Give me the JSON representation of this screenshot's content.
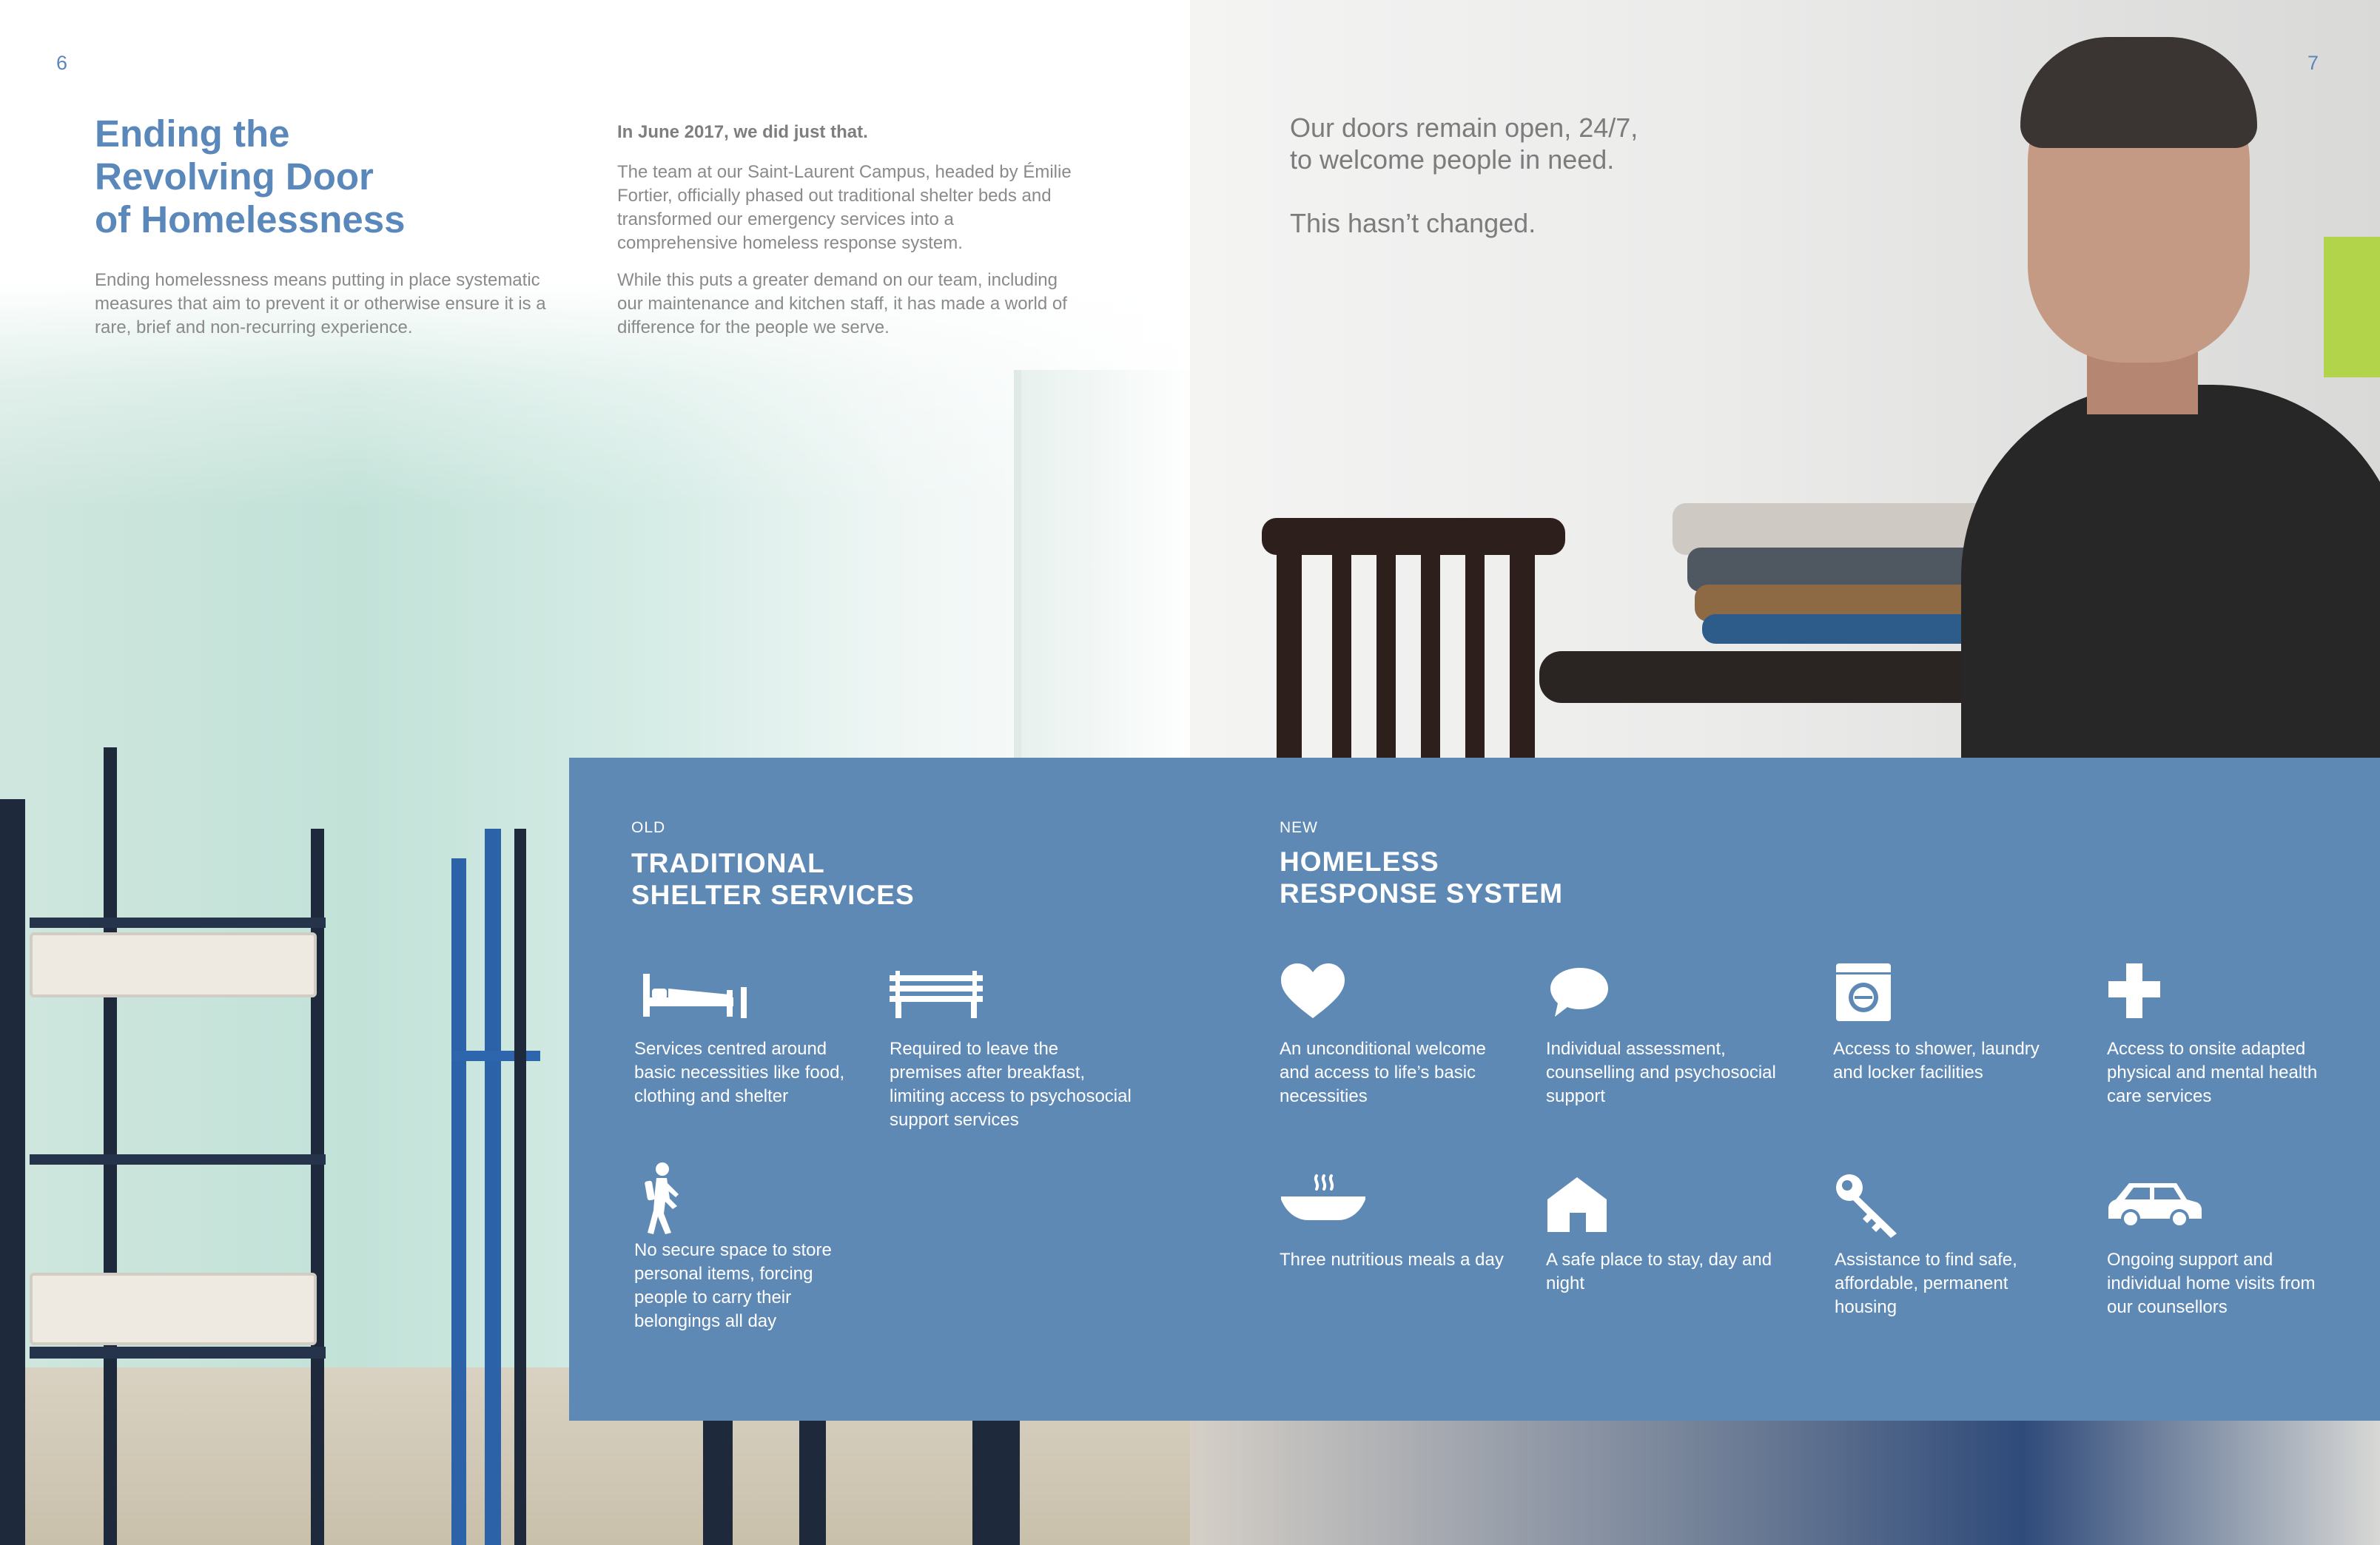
{
  "page_numbers": {
    "left": "6",
    "right": "7"
  },
  "article": {
    "title_lines": [
      "Ending the",
      "Revolving Door",
      "of Homelessness"
    ],
    "intro": "Ending homelessness means putting in place systematic measures that aim to prevent it or otherwise ensure it is a rare, brief and non-recurring experience.",
    "lead": "In June 2017, we did just that.",
    "paragraph_1": "The team at our Saint-Laurent Campus, headed by Émilie Fortier, officially phased out traditional shelter beds and transformed our emergency services into a comprehensive homeless response system.",
    "paragraph_2": "While this puts a greater demand on our team, including our maintenance and kitchen staff, it has made a world of difference for the people we serve."
  },
  "quote": {
    "line_1": "Our doors remain open, 24/7,",
    "line_2": "to welcome people in need.",
    "line_3": "This hasn’t changed."
  },
  "panel": {
    "color": "#5f89b5",
    "old": {
      "kicker": "OLD",
      "heading_lines": [
        "TRADITIONAL",
        "SHELTER SERVICES"
      ],
      "items": [
        {
          "icon": "bed-icon",
          "caption": "Services centred around basic necessities like food, clothing and shelter"
        },
        {
          "icon": "bench-icon",
          "caption": "Required to leave the premises after breakfast, limiting access to psychosocial support services"
        },
        {
          "icon": "walking-person-icon",
          "caption": "No secure space to store personal items, forcing people to carry their belongings all day"
        }
      ]
    },
    "new": {
      "kicker": "NEW",
      "heading_lines": [
        "HOMELESS",
        "RESPONSE SYSTEM"
      ],
      "items": [
        {
          "icon": "heart-icon",
          "caption": "An unconditional welcome and access to life’s basic necessities"
        },
        {
          "icon": "speech-bubble-icon",
          "caption": "Individual assessment, counselling and psychosocial support"
        },
        {
          "icon": "washing-machine-icon",
          "caption": "Access to shower, laundry and locker facilities"
        },
        {
          "icon": "medical-cross-icon",
          "caption": "Access to onsite adapted physical and mental health care services"
        },
        {
          "icon": "hot-meal-bowl-icon",
          "caption": "Three nutritious meals a day"
        },
        {
          "icon": "house-icon",
          "caption": "A safe place to stay, day and night"
        },
        {
          "icon": "key-icon",
          "caption": "Assistance to find safe, affordable, permanent housing"
        },
        {
          "icon": "car-icon",
          "caption": "Ongoing support and individual home visits from our counsellors"
        }
      ]
    }
  }
}
